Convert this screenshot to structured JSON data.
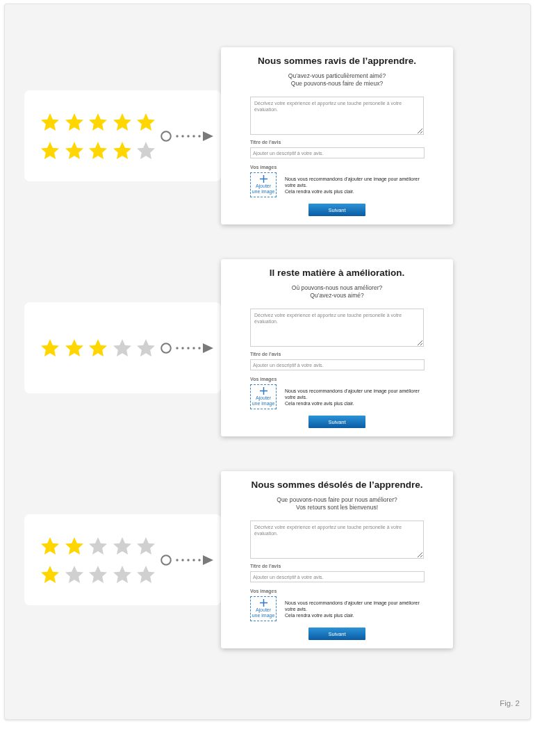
{
  "examples": [
    {
      "rating_rows": [
        {
          "stars": 5
        },
        {
          "stars": 4
        }
      ],
      "form": {
        "title": "Nous sommes ravis de l’apprendre.",
        "subtitle_lines": [
          "Qu’avez-vous particulièrement aimé?",
          "Que pouvons-nous faire de mieux?"
        ],
        "description_field": {
          "placeholder": "Décrivez votre expérience et apportez une touche personelle à votre évaluation."
        },
        "title_field": {
          "label": "Titre de l'avis",
          "placeholder": "Ajouter un descriptif à votre avis."
        },
        "images": {
          "label": "Vos images",
          "add_button_lines": [
            "Ajouter",
            "une image"
          ],
          "hint_lines": [
            "Nous vous recommandons d’ajouter une image pour améliorer votre avis.",
            "Cela rendra votre avis plus clair."
          ]
        },
        "next_button": "Suivant"
      }
    },
    {
      "rating_rows": [
        {
          "stars": 3
        }
      ],
      "form": {
        "title": "Il reste matière à amélioration.",
        "subtitle_lines": [
          "Où pouvons-nous nous améliorer?",
          "Qu’avez-vous aimé?"
        ],
        "description_field": {
          "placeholder": "Décrivez votre expérience et apportez une touche personelle à votre évaluation."
        },
        "title_field": {
          "label": "Titre de l'avis",
          "placeholder": "Ajouter un descriptif à votre avis."
        },
        "images": {
          "label": "Vos images",
          "add_button_lines": [
            "Ajouter",
            "une image"
          ],
          "hint_lines": [
            "Nous vous recommandons d’ajouter une image pour améliorer votre avis.",
            "Cela rendra votre avis plus clair."
          ]
        },
        "next_button": "Suivant"
      }
    },
    {
      "rating_rows": [
        {
          "stars": 2
        },
        {
          "stars": 1
        }
      ],
      "form": {
        "title": "Nous sommes désolés de l’apprendre.",
        "subtitle_lines": [
          "Que pouvons-nous faire pour nous améliorer?",
          "Vos retours sont les bienvenus!"
        ],
        "description_field": {
          "placeholder": "Décrivez votre expérience et apportez une touche personelle à votre évaluation."
        },
        "title_field": {
          "label": "Titre de l'avis",
          "placeholder": "Ajouter un descriptif à votre avis."
        },
        "images": {
          "label": "Vos images",
          "add_button_lines": [
            "Ajouter",
            "une image"
          ],
          "hint_lines": [
            "Nous vous recommandons d’ajouter une image pour améliorer votre avis.",
            "Cela rendra votre avis plus clair."
          ]
        },
        "next_button": "Suivant"
      }
    }
  ],
  "figure_label": "Fig. 2"
}
